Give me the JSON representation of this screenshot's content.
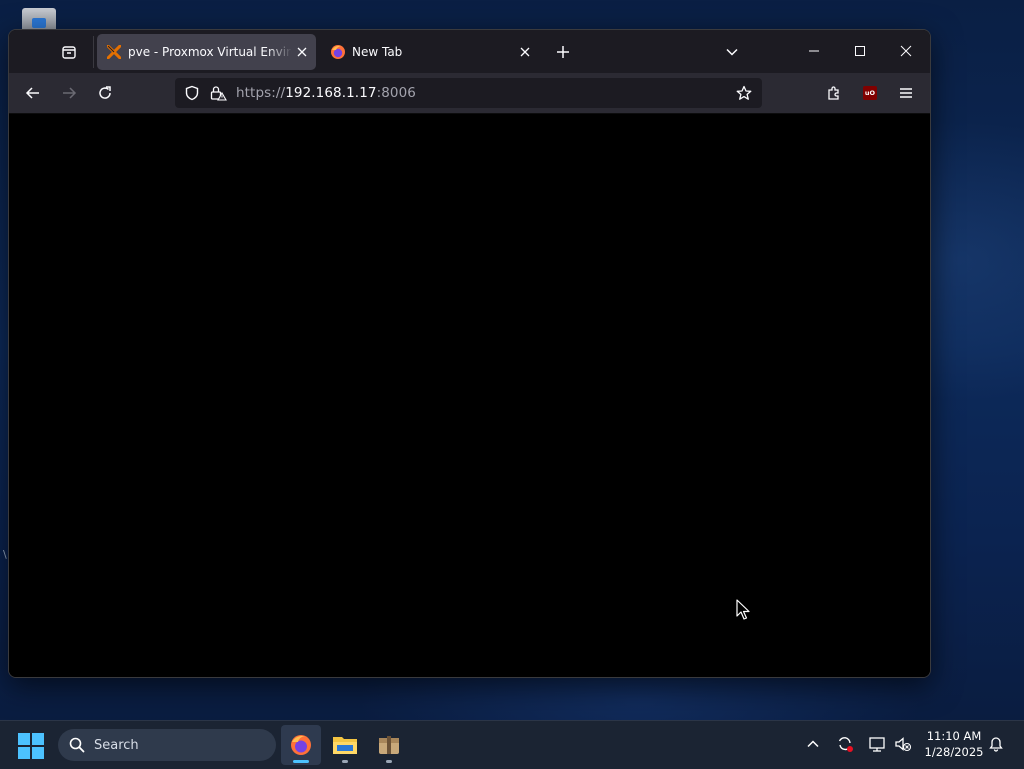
{
  "browser": {
    "tabs": [
      {
        "title": "pve - Proxmox Virtual Environment",
        "active": true
      },
      {
        "title": "New Tab",
        "active": false
      }
    ],
    "url": {
      "scheme": "https://",
      "host": "192.168.1.17",
      "port": ":8006"
    }
  },
  "taskbar": {
    "search_placeholder": "Search",
    "apps": [
      "firefox-icon",
      "file-explorer-icon",
      "package-icon"
    ],
    "clock": {
      "time": "11:10 AM",
      "date": "1/28/2025"
    }
  },
  "colors": {
    "accent": "#4cc2ff",
    "tab_active": "#42414d",
    "toolbar": "#2b2a33",
    "tabbar": "#1c1b22",
    "ublock": "#800000"
  }
}
